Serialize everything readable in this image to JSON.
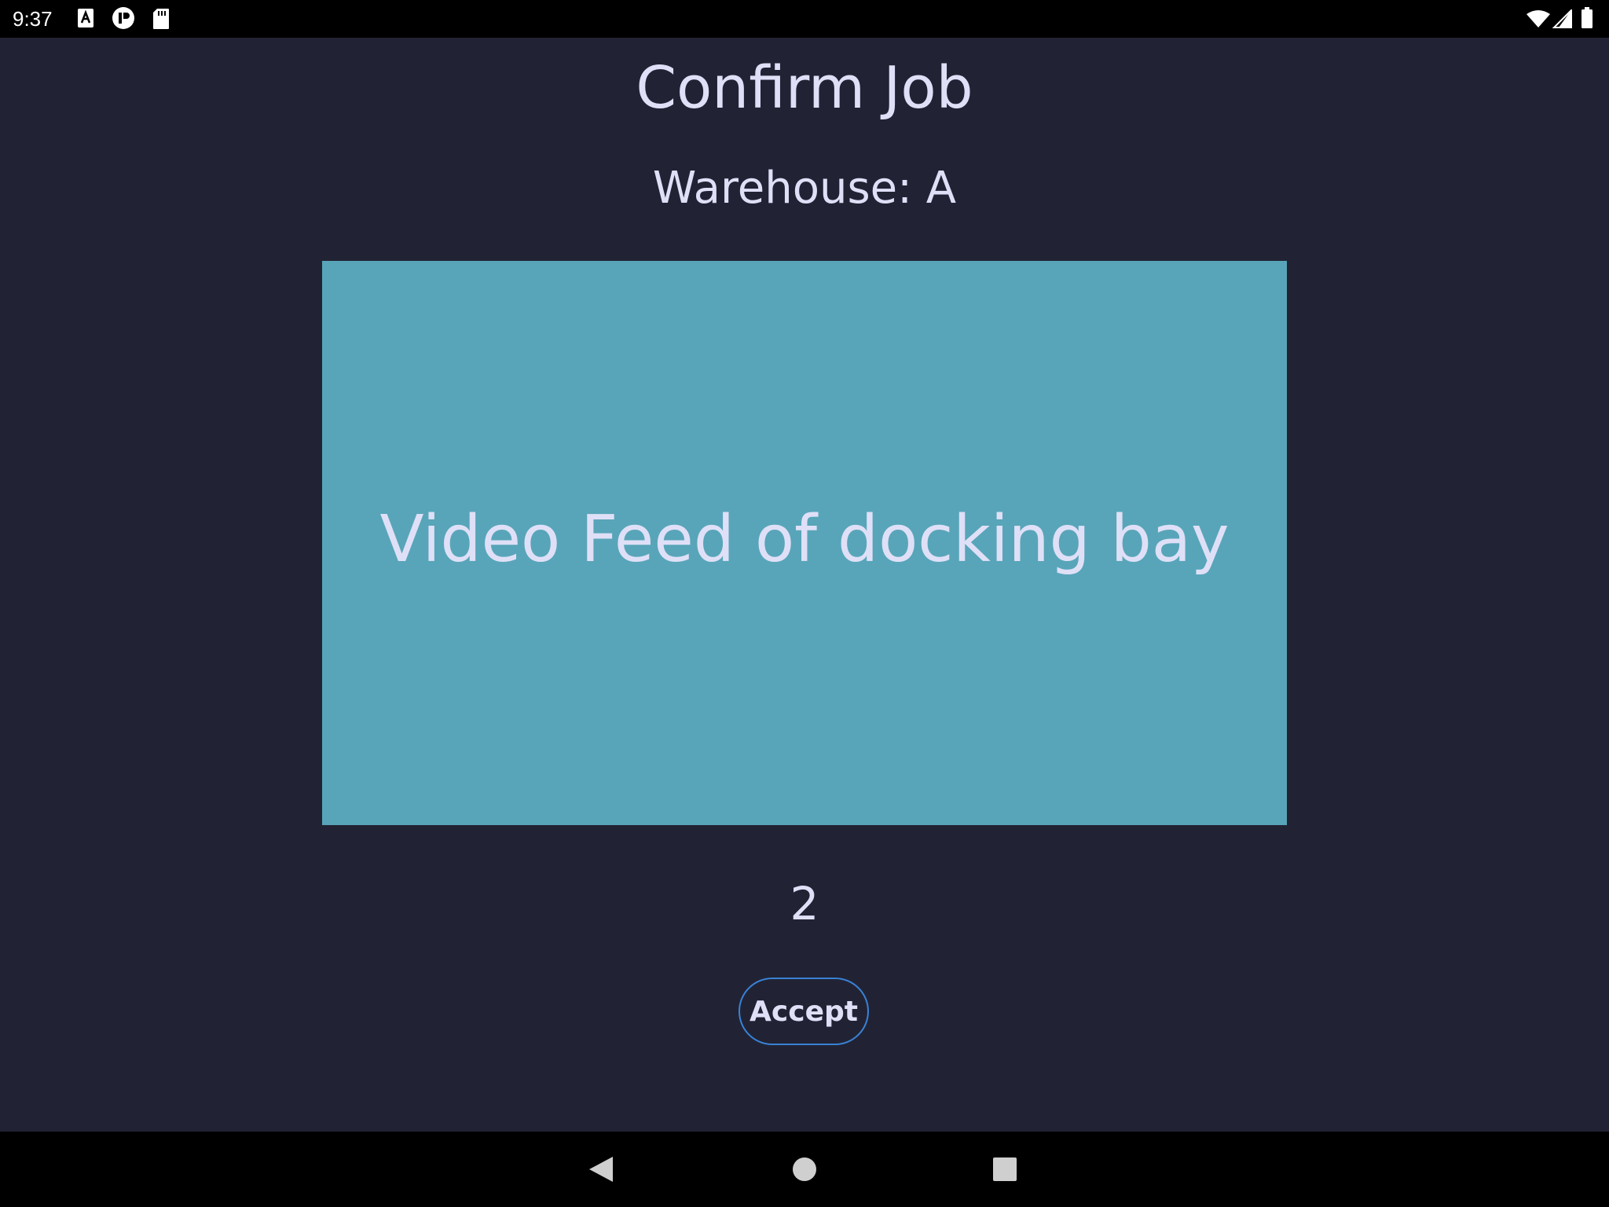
{
  "status_bar": {
    "time": "9:37",
    "left_icons": [
      "font-a-icon",
      "circle-notification-icon",
      "sd-card-icon"
    ],
    "right_icons": [
      "wifi-icon",
      "signal-icon",
      "battery-icon"
    ]
  },
  "screen": {
    "title": "Confirm Job",
    "warehouse_label": "Warehouse: A",
    "video_feed_label": "Video Feed of docking bay",
    "count": "2",
    "accept_label": "Accept"
  },
  "nav_bar": {
    "buttons": [
      "back-icon",
      "home-icon",
      "recents-icon"
    ]
  },
  "colors": {
    "background": "#212334",
    "text": "#dfe0f7",
    "video_feed": "#58a5b9",
    "button_outline": "#3a82d6"
  }
}
